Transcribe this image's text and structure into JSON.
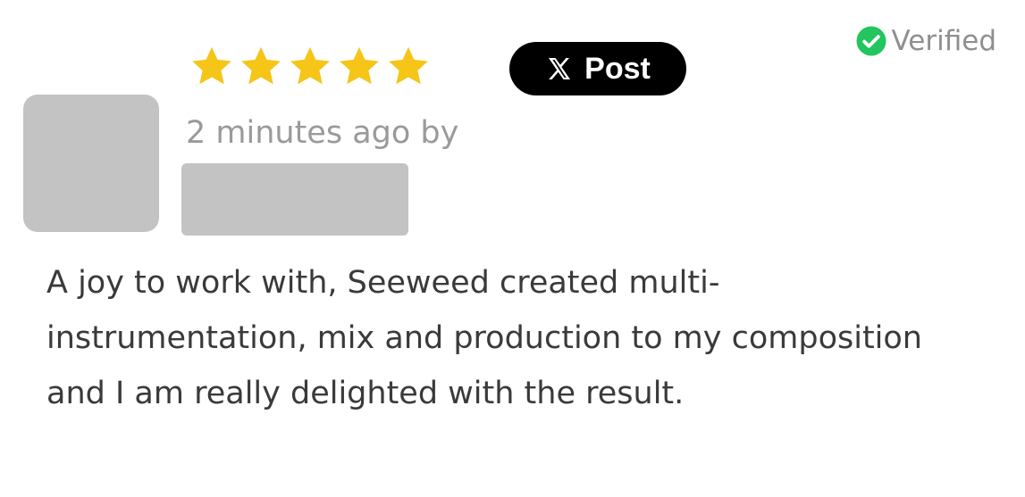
{
  "review": {
    "rating": 5,
    "rating_max": 5,
    "star_color": "#f5c518",
    "post_button": {
      "label": "Post",
      "icon": "x-logo-icon"
    },
    "verified": {
      "label": "Verified",
      "icon": "check-circle-icon",
      "color": "#22c55e"
    },
    "timestamp": "2 minutes ago by",
    "body_lines": [
      "A joy to work with, Seeweed created multi-",
      "instrumentation, mix and production to my composition",
      "and I am really delighted with the result."
    ]
  }
}
